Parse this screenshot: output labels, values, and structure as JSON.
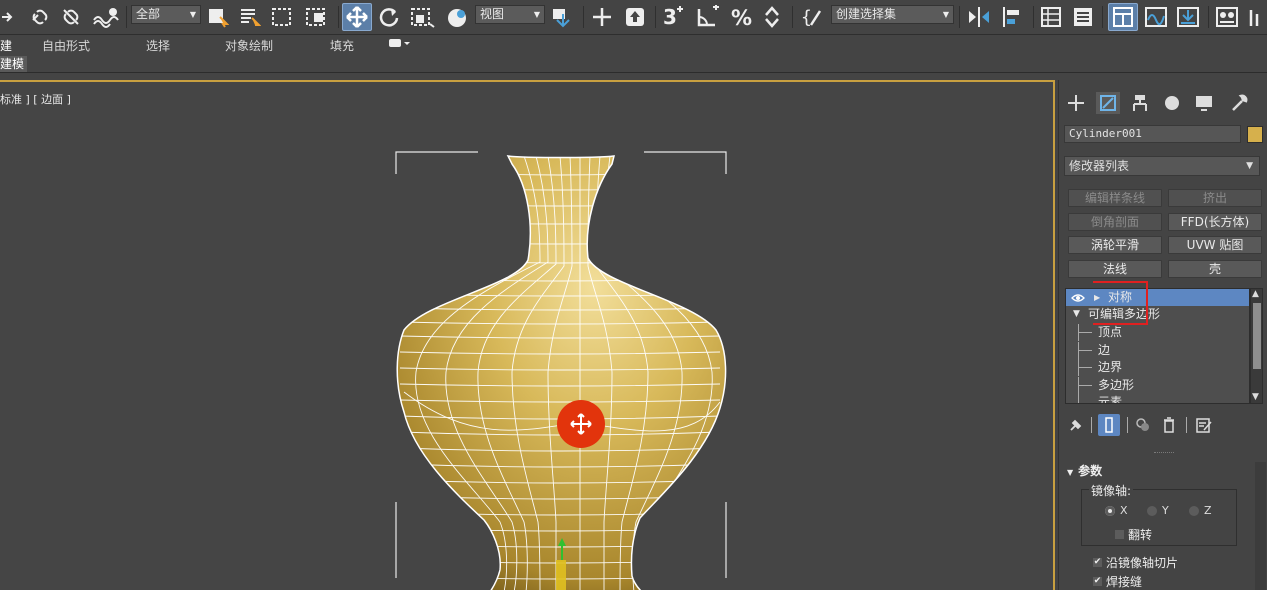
{
  "toolbar": {
    "selection_filter": "全部",
    "ref_coord": "视图",
    "named_selection": "创建选择集"
  },
  "ribbon": {
    "tabs": [
      "建",
      "自由形式",
      "选择",
      "对象绘制",
      "填充"
    ],
    "subtab": "建模"
  },
  "viewport": {
    "label": "标准 ] [ 边面 ]"
  },
  "panel": {
    "object_name": "Cylinder001",
    "object_color": "#d6b04c",
    "modifier_list": "修改器列表",
    "buttons": [
      {
        "label": "编辑样条线",
        "enabled": false
      },
      {
        "label": "挤出",
        "enabled": false
      },
      {
        "label": "倒角剖面",
        "enabled": false
      },
      {
        "label": "FFD(长方体)",
        "enabled": true
      },
      {
        "label": "涡轮平滑",
        "enabled": true
      },
      {
        "label": "UVW 贴图",
        "enabled": true
      },
      {
        "label": "法线",
        "enabled": true
      },
      {
        "label": "壳",
        "enabled": true
      }
    ],
    "stack": {
      "selected": "对称",
      "base": "可编辑多边形",
      "sub": [
        "顶点",
        "边",
        "边界",
        "多边形",
        "元素"
      ]
    },
    "params": {
      "title": "参数",
      "mirror_axis": "镜像轴:",
      "axes": [
        "X",
        "Y",
        "Z"
      ],
      "flip": "翻转",
      "slice": "沿镜像轴切片",
      "weld": "焊接缝"
    }
  }
}
